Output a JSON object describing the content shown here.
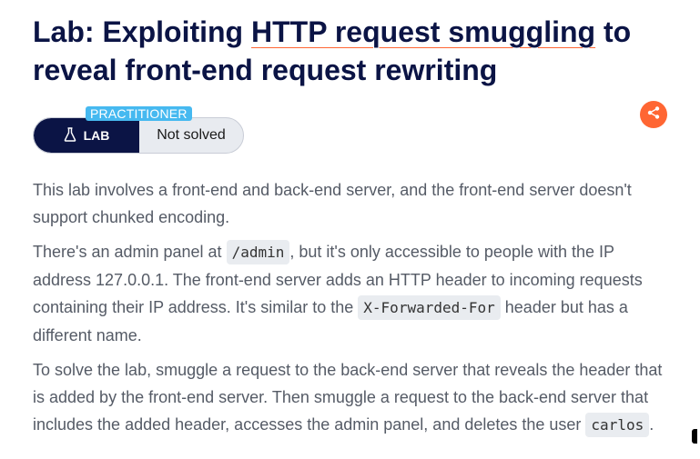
{
  "title": {
    "prefix": "Lab: Exploiting ",
    "link_text": "HTTP request smuggling",
    "suffix": " to reveal front-end request rewriting"
  },
  "badge": {
    "level": "PRACTITIONER",
    "lab_label": "LAB",
    "status": "Not solved"
  },
  "share": {
    "icon": "share-icon",
    "color": "#ff6633"
  },
  "description": {
    "p1": "This lab involves a front-end and back-end server, and the front-end server doesn't support chunked encoding.",
    "p2_a": "There's an admin panel at ",
    "p2_code1": "/admin",
    "p2_b": ", but it's only accessible to people with the IP address 127.0.0.1. The front-end server adds an HTTP header to incoming requests containing their IP address. It's similar to the ",
    "p2_code2": "X-Forwarded-For",
    "p2_c": " header but has a different name.",
    "p3_a": "To solve the lab, smuggle a request to the back-end server that reveals the header that is added by the front-end server. Then smuggle a request to the back-end server that includes the added header, accesses the admin panel, and deletes the user ",
    "p3_code": "carlos",
    "p3_b": "."
  },
  "colors": {
    "title": "#0b1445",
    "accent": "#ff6633",
    "practitioner": "#46b9f0",
    "lab_pill": "#0b1445"
  }
}
